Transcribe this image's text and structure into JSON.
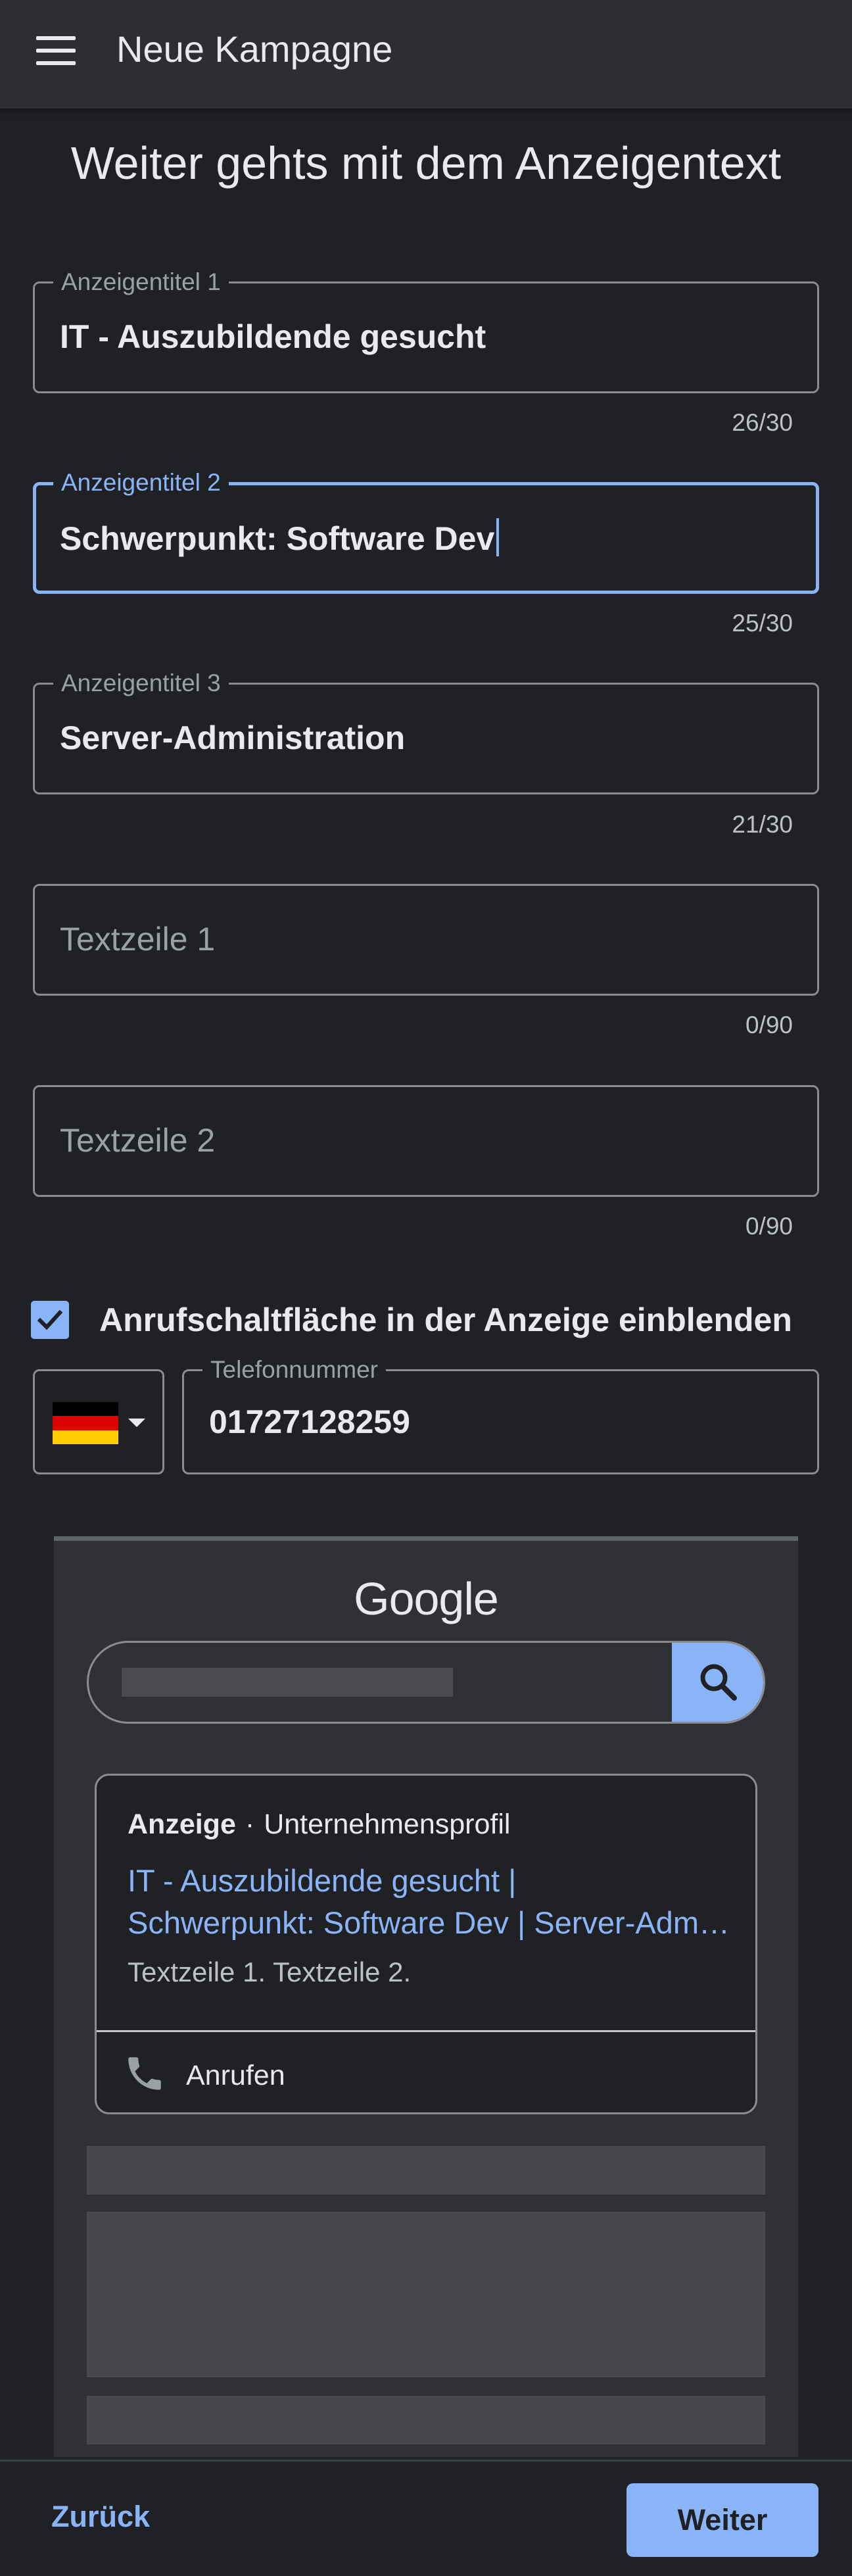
{
  "appbar": {
    "title": "Neue Kampagne",
    "menu_icon": "menu-icon"
  },
  "page_title": "Weiter gehts mit dem Anzeigentext",
  "fields": [
    {
      "label": "Anzeigentitel 1",
      "value": "IT - Auszubildende gesucht",
      "placeholder": "",
      "counter": "26/30"
    },
    {
      "label": "Anzeigentitel 2",
      "value": "Schwerpunkt: Software Dev",
      "placeholder": "",
      "counter": "25/30",
      "focused": true
    },
    {
      "label": "Anzeigentitel 3",
      "value": "Server-Administration",
      "placeholder": "",
      "counter": "21/30"
    },
    {
      "label": "",
      "value": "",
      "placeholder": "Textzeile 1",
      "counter": "0/90"
    },
    {
      "label": "",
      "value": "",
      "placeholder": "Textzeile 2",
      "counter": "0/90"
    }
  ],
  "call_option": {
    "checked": true,
    "label": "Anrufschaltfläche in der Anzeige einblenden"
  },
  "phone": {
    "country_icon": "germany-flag-icon",
    "label": "Telefonnummer",
    "value": "01727128259"
  },
  "preview": {
    "logo": "Google",
    "ad": {
      "badge": "Anzeige",
      "separator": "·",
      "profile": "Unternehmensprofil",
      "title_line1": "IT - Auszubildende gesucht |",
      "title_line2": "Schwerpunkt: Software Dev | Server-Administration",
      "description": "Textzeile 1. Textzeile 2.",
      "call_label": "Anrufen"
    }
  },
  "footer": {
    "back_label": "Zurück",
    "next_label": "Weiter"
  },
  "colors": {
    "accent": "#8ab4f8",
    "background": "#202124",
    "appbar": "#2d2e31",
    "preview_bg": "#303134"
  }
}
